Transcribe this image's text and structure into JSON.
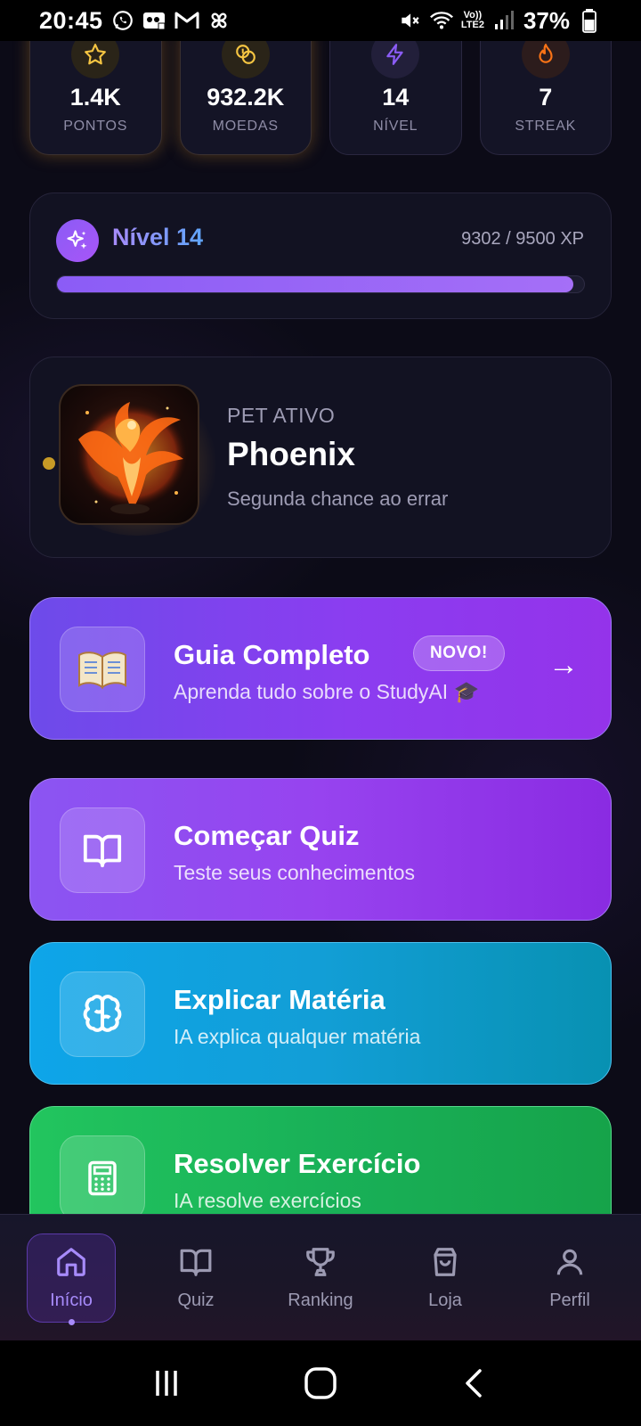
{
  "status_bar": {
    "time": "20:45",
    "battery": "37%",
    "lte_top": "Vo))",
    "lte_bottom": "LTE2"
  },
  "stats": [
    {
      "value": "1.4K",
      "label": "PONTOS",
      "icon": "star-icon",
      "color": "#f5c542"
    },
    {
      "value": "932.2K",
      "label": "MOEDAS",
      "icon": "coins-icon",
      "color": "#f5c542"
    },
    {
      "value": "14",
      "label": "NÍVEL",
      "icon": "lightning-icon",
      "color": "#8b5cf6"
    },
    {
      "value": "7",
      "label": "STREAK",
      "icon": "flame-icon",
      "color": "#f97316"
    }
  ],
  "level": {
    "title": "Nível 14",
    "xp_text": "9302 / 9500 XP",
    "progress": 0.979
  },
  "pet": {
    "label": "PET ATIVO",
    "name": "Phoenix",
    "description": "Segunda chance ao errar"
  },
  "actions": {
    "guide": {
      "title": "Guia Completo",
      "badge": "NOVO!",
      "subtitle": "Aprenda tudo sobre o StudyAI 🎓",
      "arrow": "→"
    },
    "quiz": {
      "title": "Começar Quiz",
      "subtitle": "Teste seus conhecimentos"
    },
    "explain": {
      "title": "Explicar Matéria",
      "subtitle": "IA explica qualquer matéria"
    },
    "solve": {
      "title": "Resolver Exercício",
      "subtitle": "IA resolve exercícios"
    }
  },
  "nav": {
    "home": "Início",
    "quiz": "Quiz",
    "ranking": "Ranking",
    "shop": "Loja",
    "profile": "Perfil",
    "active": "home"
  },
  "colors": {
    "accent": "#8b5cf6",
    "background": "#0c0b17"
  }
}
